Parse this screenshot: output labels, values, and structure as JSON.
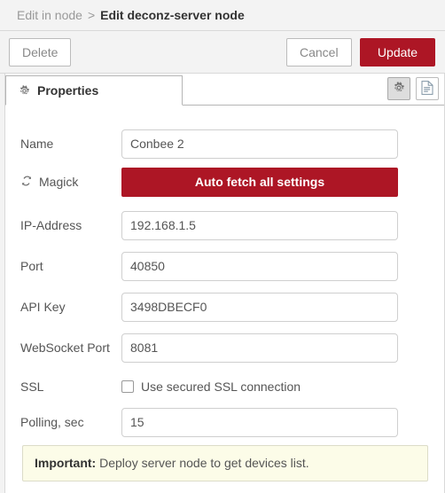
{
  "header": {
    "breadcrumb_parent": "Edit in node",
    "breadcrumb_separator": ">",
    "breadcrumb_current": "Edit deconz-server node"
  },
  "toolbar": {
    "delete_label": "Delete",
    "cancel_label": "Cancel",
    "update_label": "Update"
  },
  "tabs": [
    {
      "label": "Properties",
      "icon": "gear-icon",
      "active": true
    }
  ],
  "tab_actions": [
    {
      "name": "settings-icon-button",
      "icon": "gear-icon",
      "active": true
    },
    {
      "name": "description-icon-button",
      "icon": "document-icon",
      "active": false
    }
  ],
  "form": {
    "name": {
      "label": "Name",
      "value": "Conbee 2",
      "placeholder": "Name"
    },
    "magick": {
      "label": "Magick",
      "icon": "refresh-icon",
      "button_label": "Auto fetch all settings"
    },
    "ip_address": {
      "label": "IP-Address",
      "value": "192.168.1.5",
      "placeholder": "IP-Address"
    },
    "port": {
      "label": "Port",
      "value": "40850",
      "placeholder": "Port"
    },
    "api_key": {
      "label": "API Key",
      "value": "3498DBECF0",
      "placeholder": "API Key"
    },
    "websocket_port": {
      "label": "WebSocket Port",
      "value": "8081",
      "placeholder": "WebSocket Port"
    },
    "ssl": {
      "label": "SSL",
      "checkbox_label": "Use secured SSL connection",
      "checked": false
    },
    "polling": {
      "label": "Polling, sec",
      "value": "15",
      "placeholder": "Polling, sec"
    }
  },
  "notice": {
    "strong": "Important:",
    "text": " Deploy server node to get devices list."
  },
  "colors": {
    "primary": "#ad1625",
    "header_bg": "#f3f3f3",
    "border": "#d9d9d9",
    "notice_bg": "#fcfce8",
    "label_text": "#555555"
  }
}
